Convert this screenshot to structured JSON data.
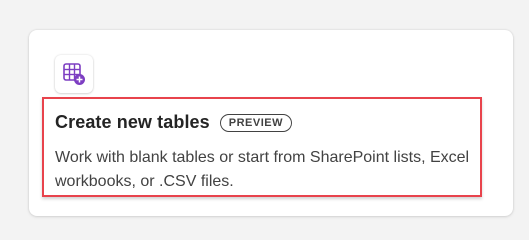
{
  "card": {
    "icon": "table-add-icon",
    "title": "Create new tables",
    "badge": "PREVIEW",
    "description": "Work with blank tables or start from SharePoint lists, Excel workbooks, or .CSV files."
  },
  "colors": {
    "highlight_border": "#e8434c",
    "icon_accent": "#7d3ec2",
    "title_text": "#242424",
    "body_text": "#424242"
  }
}
